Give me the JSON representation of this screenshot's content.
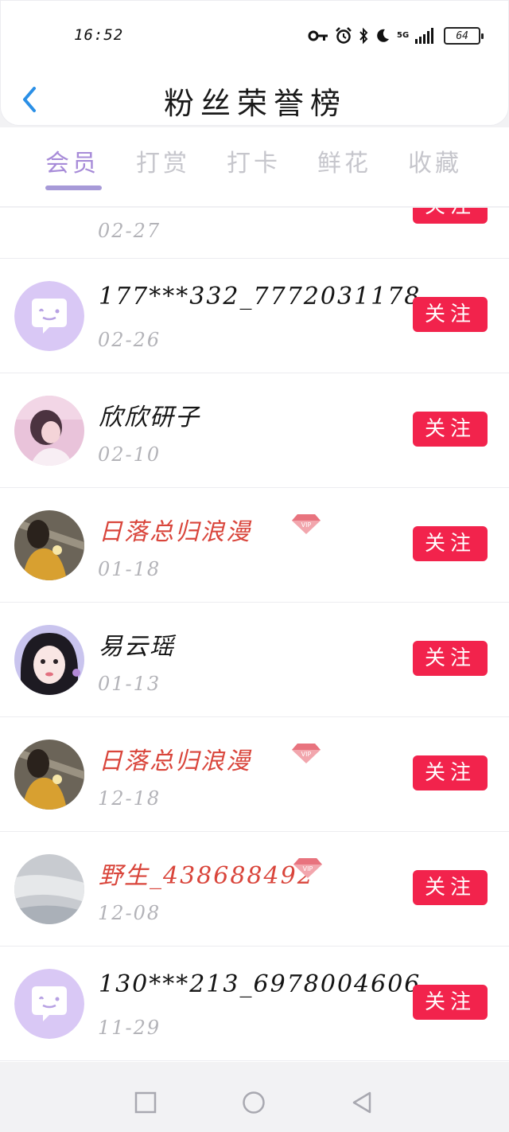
{
  "status_bar": {
    "time": "16:52",
    "network": "5G",
    "battery": "64",
    "icons": [
      "key-icon",
      "alarm-icon",
      "bluetooth-icon",
      "moon-icon",
      "signal-icon",
      "battery-icon"
    ]
  },
  "header": {
    "title": "粉丝荣誉榜",
    "back_icon": "chevron-left-icon"
  },
  "tabs": [
    {
      "label": "会员",
      "active": true
    },
    {
      "label": "打赏",
      "active": false
    },
    {
      "label": "打卡",
      "active": false
    },
    {
      "label": "鲜花",
      "active": false
    },
    {
      "label": "收藏",
      "active": false
    }
  ],
  "colors": {
    "accent": "#a78bd8",
    "follow_button": "#f2234c",
    "vip_name": "#d9453b"
  },
  "fans": [
    {
      "name": "",
      "date": "02-27",
      "vip": false,
      "follow_label": "关注"
    },
    {
      "name": "177***332_7772031178",
      "date": "02-26",
      "vip": false,
      "follow_label": "关注"
    },
    {
      "name": "欣欣研子",
      "date": "02-10",
      "vip": false,
      "follow_label": "关注"
    },
    {
      "name": "日落总归浪漫",
      "date": "01-18",
      "vip": true,
      "follow_label": "关注"
    },
    {
      "name": "易云瑶",
      "date": "01-13",
      "vip": false,
      "follow_label": "关注"
    },
    {
      "name": "日落总归浪漫",
      "date": "12-18",
      "vip": true,
      "follow_label": "关注"
    },
    {
      "name": "野生_438688492",
      "date": "12-08",
      "vip": true,
      "follow_label": "关注"
    },
    {
      "name": "130***213_6978004606",
      "date": "11-29",
      "vip": false,
      "follow_label": "关注"
    }
  ],
  "vip_badge_text": "VIP",
  "nav_bar": [
    "square-icon",
    "circle-icon",
    "triangle-back-icon"
  ]
}
